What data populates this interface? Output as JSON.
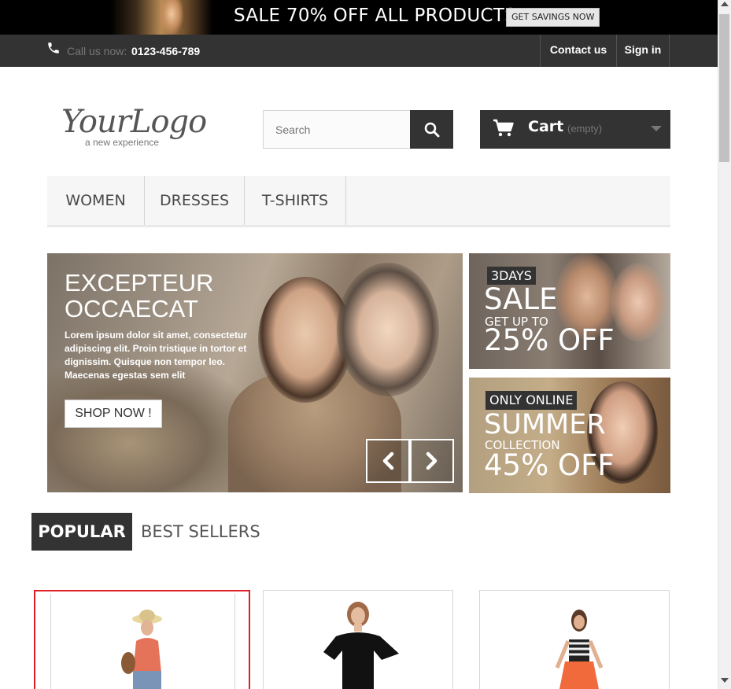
{
  "promo": {
    "text": "SALE 70% OFF ALL PRODUCTS",
    "button_label": "GET SAVINGS NOW"
  },
  "nav": {
    "call_label": "Call us now:",
    "phone": "0123-456-789",
    "contact_label": "Contact us",
    "signin_label": "Sign in"
  },
  "header": {
    "logo_main": "YourLogo",
    "logo_sub": "a new experience",
    "search_placeholder": "Search",
    "cart_label": "Cart",
    "cart_status": "(empty)"
  },
  "menu": {
    "items": [
      {
        "label": "WOMEN"
      },
      {
        "label": "DRESSES"
      },
      {
        "label": "T-SHIRTS"
      }
    ]
  },
  "slider": {
    "title_line1": "EXCEPTEUR",
    "title_line2": "OCCAECAT",
    "text": "Lorem ipsum dolor sit amet, consectetur adipiscing elit. Proin tristique in tortor et dignissim. Quisque non tempor leo. Maecenas egestas sem elit",
    "button_label": "SHOP NOW !"
  },
  "banners": [
    {
      "tag": "3DAYS",
      "big": "SALE",
      "small": "GET UP TO",
      "pct": "25% OFF"
    },
    {
      "tag": "ONLY ONLINE",
      "big": "SUMMER",
      "small": "COLLECTION",
      "pct": "45% OFF"
    }
  ],
  "tabs": {
    "active": "POPULAR",
    "other": "BEST SELLERS"
  },
  "icons": {
    "phone": "phone-icon",
    "search": "search-icon",
    "cart": "cart-icon",
    "arrow_prev": "chevron-left-icon",
    "arrow_next": "chevron-right-icon"
  },
  "colors": {
    "dark": "#333333",
    "selected_border": "#e01e26"
  }
}
